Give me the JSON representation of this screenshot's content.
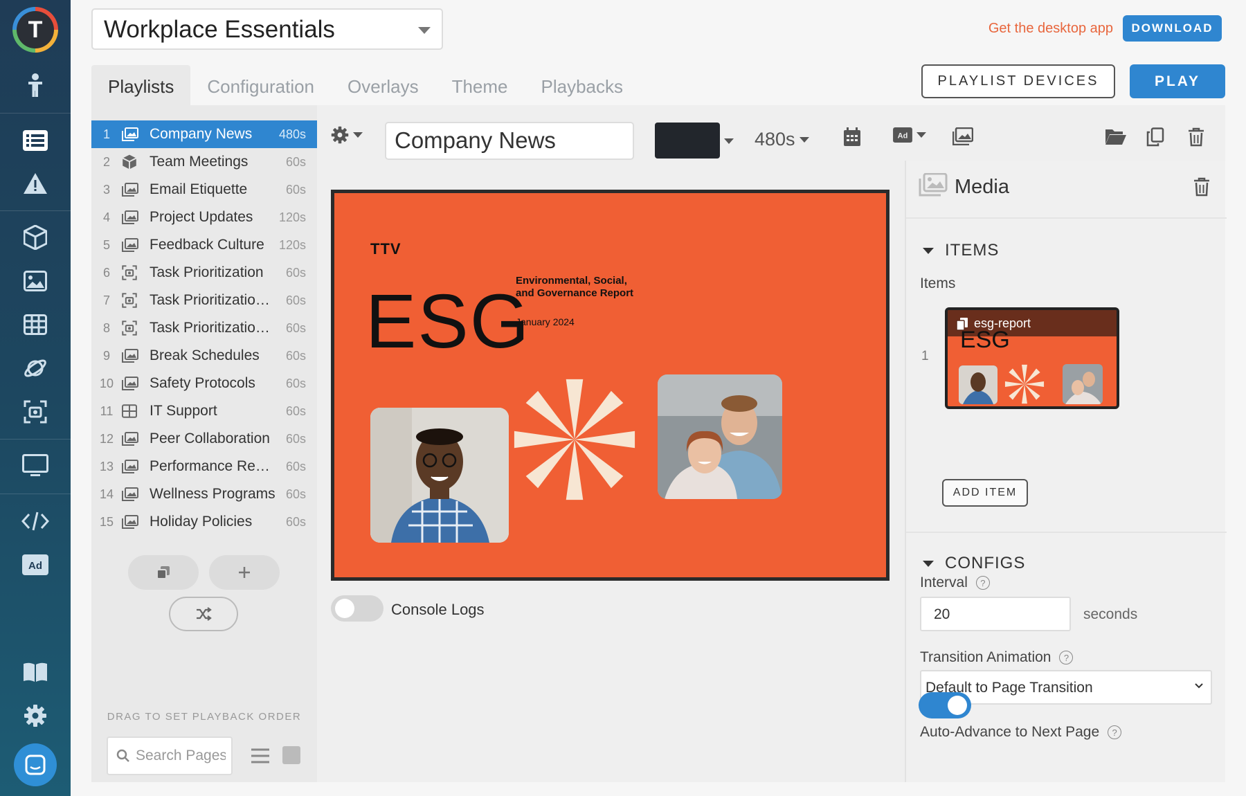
{
  "app": {
    "logo_letter": "T",
    "workspace": "Workplace Essentials",
    "desktop_link": "Get the desktop app",
    "download_label": "DOWNLOAD"
  },
  "tabs": [
    {
      "label": "Playlists",
      "active": true
    },
    {
      "label": "Configuration"
    },
    {
      "label": "Overlays"
    },
    {
      "label": "Theme"
    },
    {
      "label": "Playbacks"
    }
  ],
  "actions": {
    "playlist_devices": "PLAYLIST DEVICES",
    "play": "PLAY"
  },
  "playlists": [
    {
      "num": "1",
      "name": "Company News",
      "duration": "480s",
      "icon": "image-gallery-icon",
      "active": true
    },
    {
      "num": "2",
      "name": "Team Meetings",
      "duration": "60s",
      "icon": "cube-icon"
    },
    {
      "num": "3",
      "name": "Email Etiquette",
      "duration": "60s",
      "icon": "image-gallery-icon"
    },
    {
      "num": "4",
      "name": "Project Updates",
      "duration": "120s",
      "icon": "image-gallery-icon"
    },
    {
      "num": "5",
      "name": "Feedback Culture",
      "duration": "120s",
      "icon": "image-gallery-icon"
    },
    {
      "num": "6",
      "name": "Task Prioritization",
      "duration": "60s",
      "icon": "screenshot-icon"
    },
    {
      "num": "7",
      "name": "Task Prioritization 2",
      "duration": "60s",
      "icon": "screenshot-icon"
    },
    {
      "num": "8",
      "name": "Task Prioritization 3",
      "duration": "60s",
      "icon": "screenshot-icon"
    },
    {
      "num": "9",
      "name": "Break Schedules",
      "duration": "60s",
      "icon": "image-gallery-icon"
    },
    {
      "num": "10",
      "name": "Safety Protocols",
      "duration": "60s",
      "icon": "image-gallery-icon"
    },
    {
      "num": "11",
      "name": "IT Support",
      "duration": "60s",
      "icon": "grid-icon"
    },
    {
      "num": "12",
      "name": "Peer Collaboration",
      "duration": "60s",
      "icon": "image-gallery-icon"
    },
    {
      "num": "13",
      "name": "Performance Revie...",
      "duration": "60s",
      "icon": "image-gallery-icon"
    },
    {
      "num": "14",
      "name": "Wellness Programs",
      "duration": "60s",
      "icon": "image-gallery-icon"
    },
    {
      "num": "15",
      "name": "Holiday Policies",
      "duration": "60s",
      "icon": "image-gallery-icon"
    }
  ],
  "playlist_footer": {
    "drag_hint": "DRAG TO SET PLAYBACK ORDER",
    "search_placeholder": "Search Pages"
  },
  "editor": {
    "page_name": "Company News",
    "background_color": "#22262c",
    "duration": "480s",
    "console_logs_label": "Console Logs",
    "console_logs_on": false
  },
  "preview": {
    "brand": "TTV",
    "headline": "ESG",
    "subtitle_line1": "Environmental, Social,",
    "subtitle_line2": "and Governance Report",
    "date": "January 2024",
    "background": "#f05f34"
  },
  "media_panel": {
    "title": "Media",
    "items_section": "ITEMS",
    "items_label": "Items",
    "item_index": "1",
    "item_name": "esg-report",
    "add_item_label": "ADD ITEM",
    "configs_section": "CONFIGS",
    "interval_label": "Interval",
    "interval_value": "20",
    "interval_unit": "seconds",
    "transition_label": "Transition Animation",
    "transition_value": "Default to Page Transition",
    "auto_advance_label": "Auto-Advance to Next Page",
    "auto_advance_on": true,
    "help_glyph": "?"
  },
  "colors": {
    "accent": "#2f86d0",
    "brand_orange": "#f05f34",
    "link_orange": "#e8663d"
  }
}
